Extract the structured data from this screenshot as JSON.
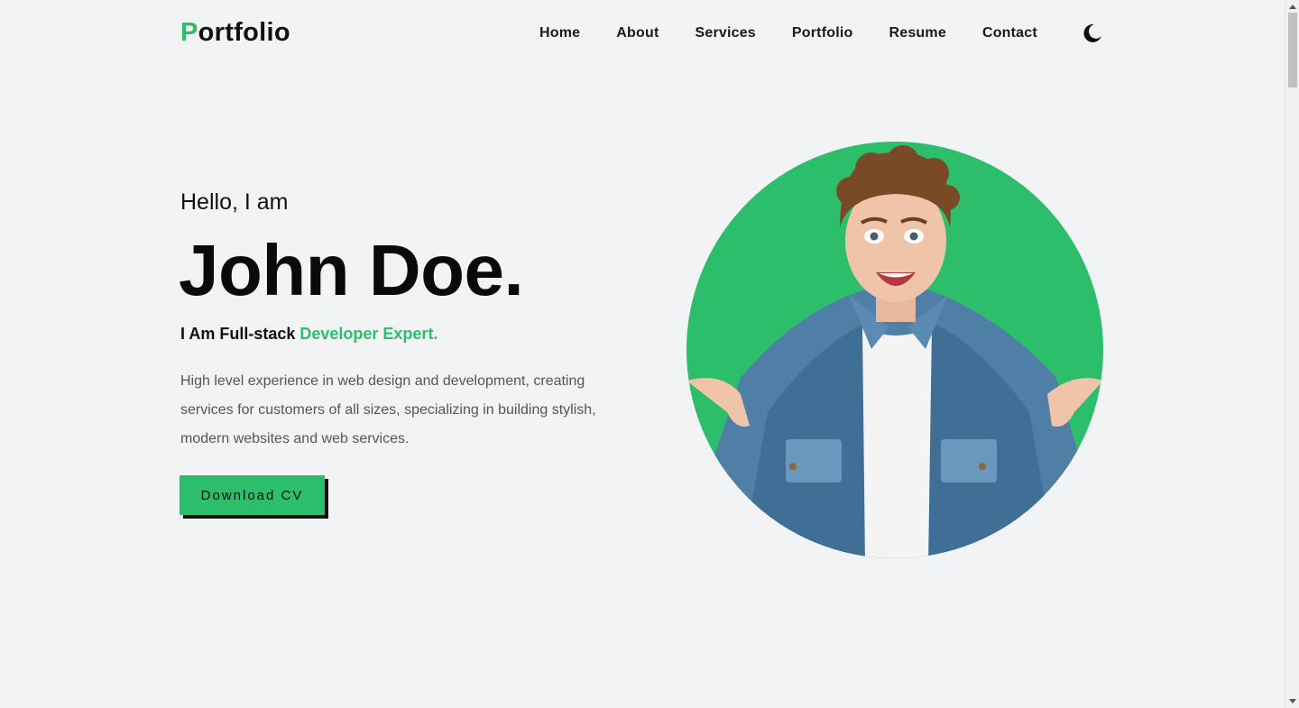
{
  "header": {
    "logo_first": "P",
    "logo_rest": "ortfolio",
    "nav": [
      "Home",
      "About",
      "Services",
      "Portfolio",
      "Resume",
      "Contact"
    ],
    "theme_icon": "moon-icon"
  },
  "hero": {
    "greeting": "Hello, I am",
    "name": "John Doe.",
    "role_prefix": "I Am Full-stack ",
    "role_accent": "Developer Expert.",
    "description": "High level experience in web design and development, creating services for customers of all sizes, specializing in building stylish, modern websites and web services.",
    "cv_button": "Download CV"
  },
  "colors": {
    "accent": "#2dbe6c",
    "background": "#f2f3f5",
    "text": "#111111"
  }
}
